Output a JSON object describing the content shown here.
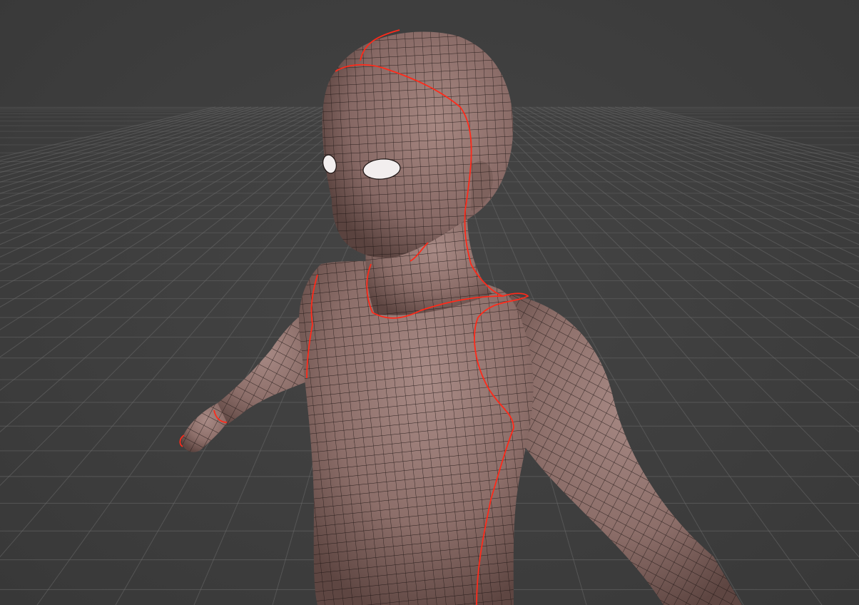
{
  "viewport": {
    "mode": "3d-viewport",
    "background_color": "#3d3d3d",
    "grid_color": "#6a6a6a",
    "grid_visible": true,
    "shading": "solid-with-wireframe-overlay"
  },
  "model": {
    "object": "humanoid-base-mesh",
    "skin_color": "#8c6e69",
    "wire_color": "#1a1211",
    "seam_color": "#ff2a1a",
    "eye_color": "#f2eeee",
    "visible_parts": [
      "head",
      "ears",
      "eyes",
      "neck",
      "torso",
      "left-arm",
      "left-hand",
      "right-arm"
    ]
  }
}
